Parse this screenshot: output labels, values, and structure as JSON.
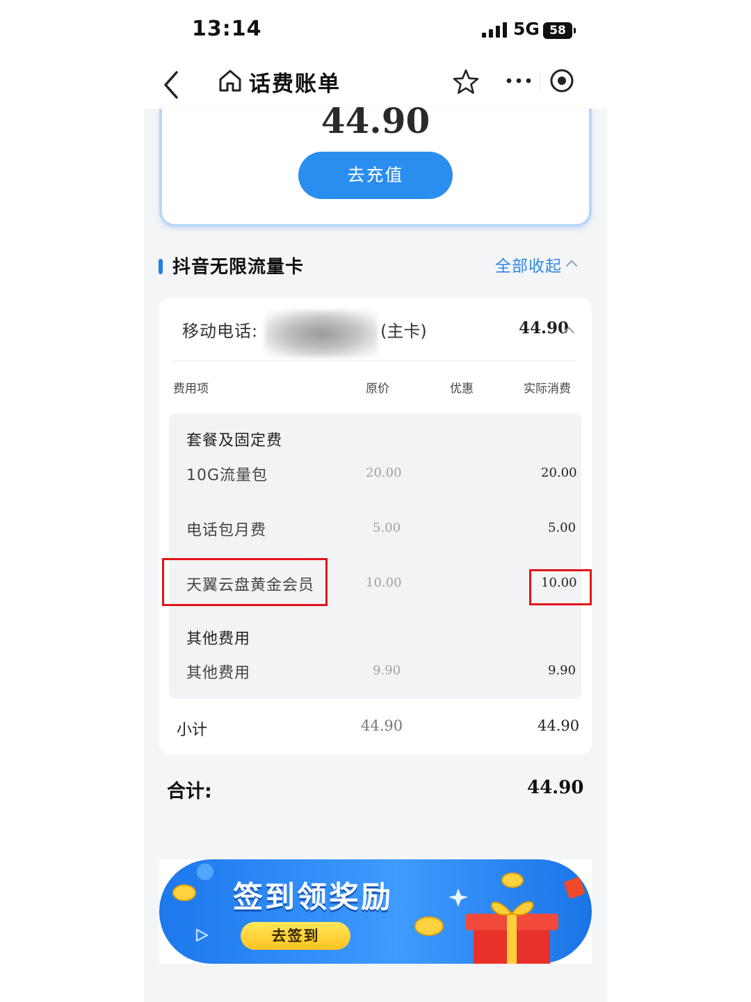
{
  "status_bar": {
    "time": "13:14",
    "network": "5G",
    "battery": "58"
  },
  "nav": {
    "title": "话费账单"
  },
  "summary": {
    "balance": "44.90",
    "recharge_label": "去充值"
  },
  "section": {
    "title": "抖音无限流量卡",
    "collapse_label": "全部收起"
  },
  "line": {
    "label": "移动电话:",
    "type": "(主卡)",
    "amount": "44.90"
  },
  "table": {
    "headers": {
      "item": "费用项",
      "original": "原价",
      "discount": "优惠",
      "actual": "实际消费"
    },
    "groups": [
      {
        "title": "套餐及固定费",
        "items": [
          {
            "name": "10G流量包",
            "original": "20.00",
            "actual": "20.00"
          },
          {
            "name": "电话包月费",
            "original": "5.00",
            "actual": "5.00"
          },
          {
            "name": "天翼云盘黄金会员",
            "original": "10.00",
            "actual": "10.00"
          }
        ]
      },
      {
        "title": "其他费用",
        "items": [
          {
            "name": "其他费用",
            "original": "9.90",
            "actual": "9.90"
          }
        ]
      }
    ],
    "subtotal": {
      "label": "小计",
      "original": "44.90",
      "actual": "44.90"
    }
  },
  "total": {
    "label": "合计:",
    "amount": "44.90"
  },
  "banner": {
    "title": "签到领奖励",
    "button": "去签到"
  },
  "colors": {
    "accent": "#2a8df0",
    "highlight": "#e01418",
    "page_bg": "#f4f5f6"
  }
}
